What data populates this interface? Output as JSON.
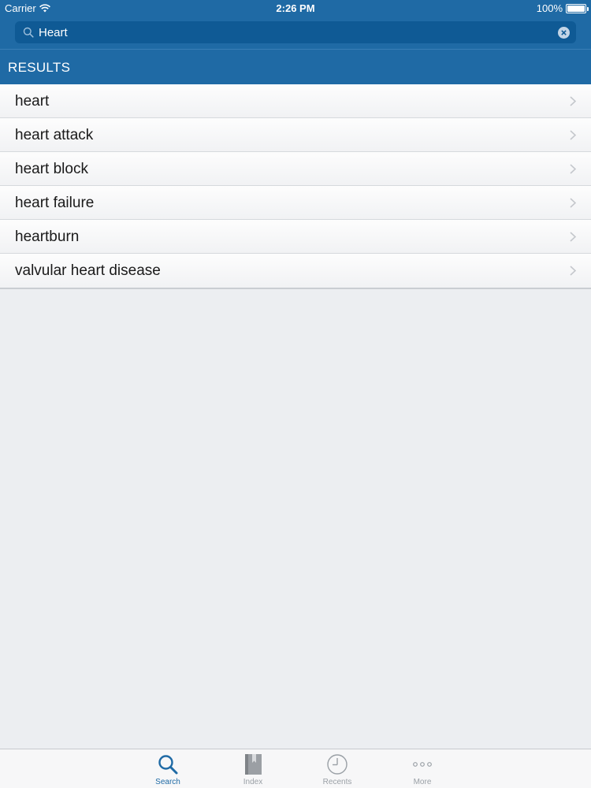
{
  "status_bar": {
    "carrier": "Carrier",
    "time": "2:26 PM",
    "battery": "100%"
  },
  "search": {
    "value": "Heart",
    "placeholder": "Search"
  },
  "results_header": {
    "title": "RESULTS"
  },
  "results": [
    {
      "label": "heart"
    },
    {
      "label": "heart attack"
    },
    {
      "label": "heart block"
    },
    {
      "label": "heart failure"
    },
    {
      "label": "heartburn"
    },
    {
      "label": "valvular heart disease"
    }
  ],
  "tab_bar": {
    "tabs": [
      {
        "label": "Search",
        "icon": "search-icon",
        "active": true
      },
      {
        "label": "Index",
        "icon": "book-icon",
        "active": false
      },
      {
        "label": "Recents",
        "icon": "clock-icon",
        "active": false
      },
      {
        "label": "More",
        "icon": "more-dots-icon",
        "active": false
      }
    ]
  },
  "colors": {
    "header_blue": "#1f6aa5",
    "search_field": "#0f5a95",
    "background": "#eceef1",
    "active_tab": "#1f6aa5",
    "inactive_tab": "#9aa0a6"
  }
}
